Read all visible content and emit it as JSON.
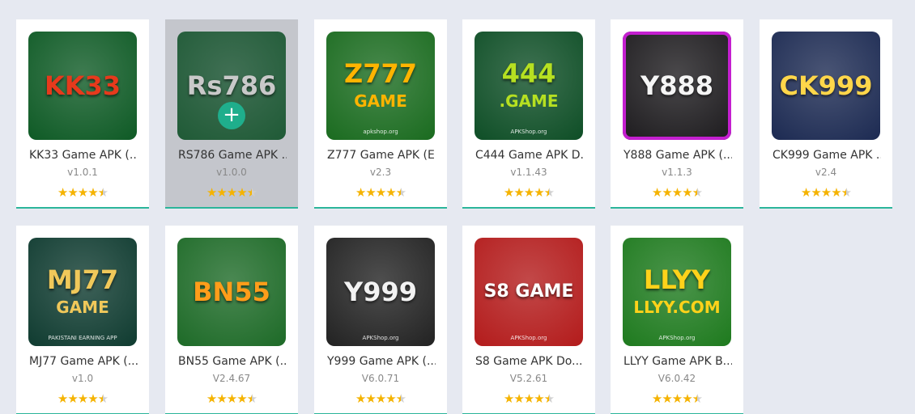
{
  "apps": [
    {
      "title": "KK33 Game APK (...",
      "version": "v1.0.1",
      "logo": "KK33",
      "logo_top": "KK33",
      "bg": "#0e5a25",
      "fg": "#e63a1c",
      "rating": 4.5
    },
    {
      "title": "RS786 Game APK ...",
      "version": "v1.0.0",
      "logo": "Rs786",
      "bg": "#1f5a36",
      "fg": "#c9c9c9",
      "rating": 4.5,
      "hover": true
    },
    {
      "title": "Z777 Game APK (E...",
      "version": "v2.3",
      "logo": "Z777",
      "sub": "GAME",
      "tag": "apkshop.org",
      "bg": "#1a6b1f",
      "fg": "#ffb400",
      "rating": 4.5
    },
    {
      "title": "C444 Game APK D...",
      "version": "v1.1.43",
      "logo": "444",
      "sub": ".GAME",
      "tag": "APKShop.org",
      "bg": "#0e4e26",
      "fg": "#b6e021",
      "rating": 4.5
    },
    {
      "title": "Y888 Game APK (...",
      "version": "v1.1.3",
      "logo": "Y888",
      "bg": "#1d1b1e",
      "fg": "#f5f5f5",
      "border": "#c41fd0",
      "rating": 4.5
    },
    {
      "title": "CK999 Game APK ...",
      "version": "v2.4",
      "logo": "CK999",
      "bg": "#1c2a52",
      "fg": "#ffd64a",
      "rating": 4.5
    },
    {
      "title": "MJ77 Game APK (...",
      "version": "v1.0",
      "logo": "MJ77",
      "sub": "GAME",
      "tag": "PAKISTANI EARNING APP",
      "bg": "#0f3b30",
      "fg": "#f0c85a",
      "rating": 4.5
    },
    {
      "title": "BN55 Game APK (...",
      "version": "V2.4.67",
      "logo": "BN55",
      "bg": "#1d6a27",
      "fg": "#ff9d1a",
      "rating": 4.5
    },
    {
      "title": "Y999 Game APK (...",
      "version": "V6.0.71",
      "logo": "Y999",
      "tag": "APKShop.org",
      "bg": "#222222",
      "fg": "#f2f2f2",
      "rating": 4.5
    },
    {
      "title": "S8 Game APK Do...",
      "version": "V5.2.61",
      "logo": "S8 GAME",
      "tag": "APKShop.org",
      "bg": "#b31b1b",
      "fg": "#ffffff",
      "rating": 4.5
    },
    {
      "title": "LLYY Game APK B...",
      "version": "V6.0.42",
      "logo": "LLYY",
      "sub": "LLYY.COM",
      "tag": "APKShop.org",
      "bg": "#1e7a1e",
      "fg": "#ffd21a",
      "rating": 4.5
    }
  ],
  "actions": {
    "install_symbol": "+"
  },
  "colors": {
    "page_bg": "#e6e9f1",
    "accent": "#2bb59a",
    "star": "#f5b301",
    "install_button": "#1fae8c"
  }
}
